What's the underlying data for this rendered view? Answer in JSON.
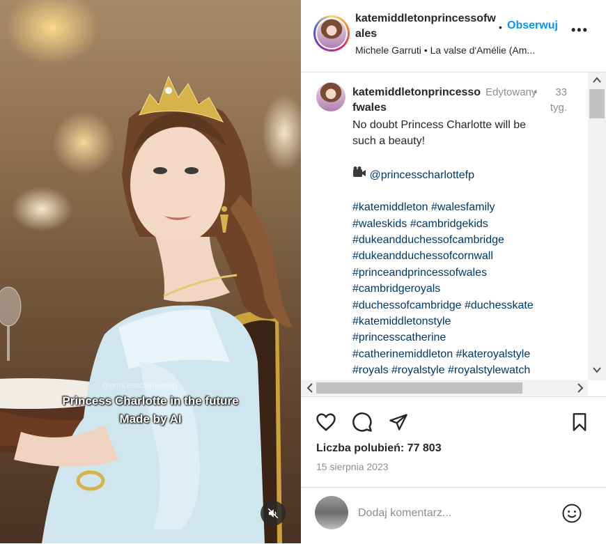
{
  "media": {
    "watermark": "@princesscharlottefp",
    "caption_line1": "Princess Charlotte in the future",
    "caption_line2": "Made by AI"
  },
  "header": {
    "username": "katemiddletonprincessofwales",
    "separator": "•",
    "follow_label": "Obserwuj",
    "more_label": "•••",
    "audio": "Michele Garruti • La valse d'Amélie (Am..."
  },
  "caption": {
    "username": "katemiddletonprincessofwales",
    "edited": "Edytowany",
    "separator": "•",
    "time": "33 tyg.",
    "text_line1": "No doubt Princess Charlotte will be",
    "text_line2": "such a beauty!",
    "mention": "@princesscharlottefp",
    "hashtag_lines": [
      "#katemiddleton #walesfamily",
      "#waleskids #cambridgekids",
      "#dukeandduchessofcambridge",
      "#dukeandduchessofcornwall",
      "#princeandprincessofwales",
      "#cambridgeroyals",
      "#duchessofcambridge #duchesskate",
      "#katemiddletonstyle",
      "#princesscatherine",
      "#catherinemiddleton #kateroyalstyle",
      "#royals #royalstyle #royalstylewatch"
    ]
  },
  "stats": {
    "likes": "Liczba polubień: 77 803",
    "date": "15 sierpnia 2023"
  },
  "comment_box": {
    "placeholder": "Dodaj komentarz..."
  },
  "icons": {
    "like": "heart-icon",
    "comment": "comment-icon",
    "share": "send-icon",
    "save": "bookmark-icon",
    "mute": "speaker-muted-icon",
    "emoji": "smiley-icon",
    "more": "more-icon"
  },
  "colors": {
    "accent": "#0095f6",
    "hashtag": "#00376b",
    "muted_text": "#8e8e8e",
    "border": "#dbdbdb"
  }
}
